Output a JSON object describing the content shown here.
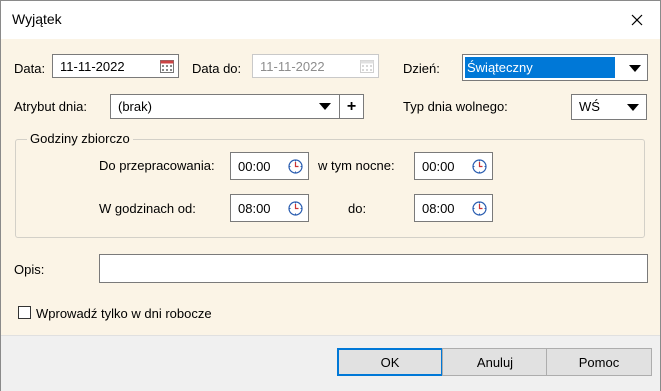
{
  "window": {
    "title": "Wyjątek"
  },
  "date_row": {
    "data_label": "Data:",
    "data_value": "11-11-2022",
    "data_do_label": "Data do:",
    "data_do_value": "11-11-2022",
    "dzien_label": "Dzień:",
    "dzien_value": "Świąteczny"
  },
  "attr_row": {
    "atrybut_label": "Atrybut dnia:",
    "atrybut_value": "(brak)",
    "add_label": "+",
    "typ_label": "Typ dnia wolnego:",
    "typ_value": "WŚ"
  },
  "hours_group": {
    "title": "Godziny zbiorczo",
    "do_przepracowania_label": "Do przepracowania:",
    "do_przepracowania_value": "00:00",
    "w_tym_nocne_label": "w tym nocne:",
    "w_tym_nocne_value": "00:00",
    "w_godzinach_od_label": "W godzinach od:",
    "w_godzinach_od_value": "08:00",
    "do_label": "do:",
    "do_value": "08:00"
  },
  "opis": {
    "label": "Opis:",
    "value": ""
  },
  "checkbox": {
    "label": "Wprowadź tylko w dni robocze",
    "checked": false
  },
  "buttons": {
    "ok": "OK",
    "cancel": "Anuluj",
    "help": "Pomoc"
  },
  "colors": {
    "selection": "#0078d7",
    "background": "#fbf4e6",
    "button": "#e1e1e1"
  }
}
